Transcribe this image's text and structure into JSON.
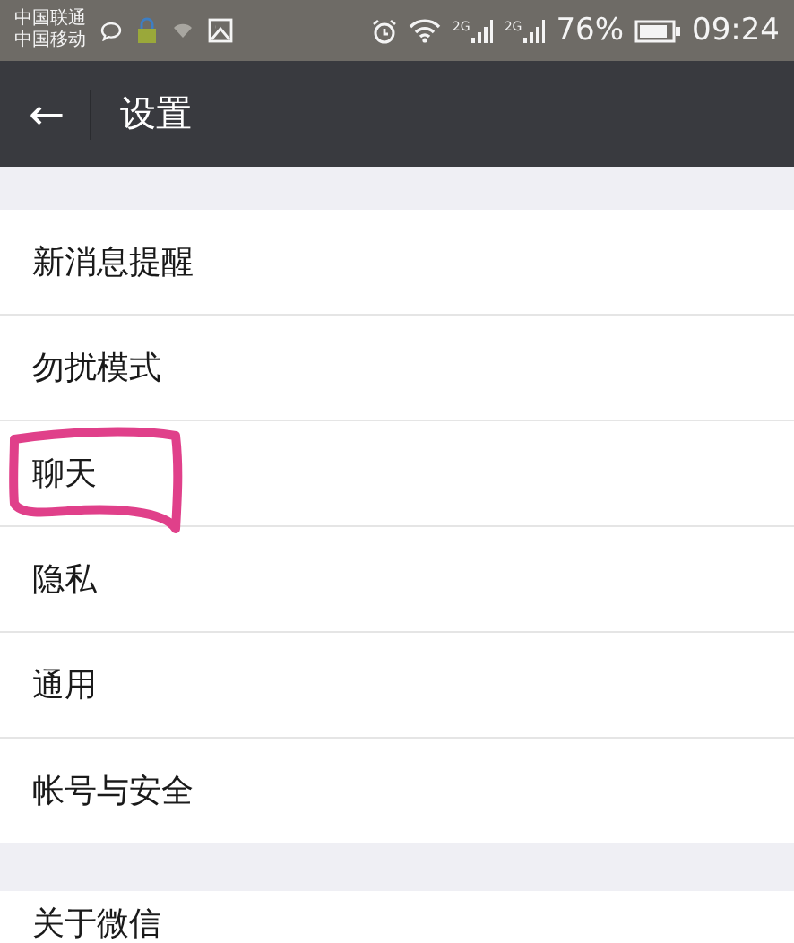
{
  "status_bar": {
    "carriers": [
      "中国联通",
      "中国移动"
    ],
    "signals": [
      {
        "network": "2G"
      },
      {
        "network": "2G"
      }
    ],
    "battery": "76%",
    "time": "09:24"
  },
  "toolbar": {
    "back": "←",
    "title": "设置"
  },
  "groups": [
    {
      "items": [
        {
          "label": "新消息提醒",
          "highlighted": false
        },
        {
          "label": "勿扰模式",
          "highlighted": false
        },
        {
          "label": "聊天",
          "highlighted": true
        },
        {
          "label": "隐私",
          "highlighted": false
        },
        {
          "label": "通用",
          "highlighted": false
        },
        {
          "label": "帐号与安全",
          "highlighted": false
        }
      ]
    },
    {
      "items": [
        {
          "label": "关于微信",
          "highlighted": false
        }
      ]
    }
  ]
}
